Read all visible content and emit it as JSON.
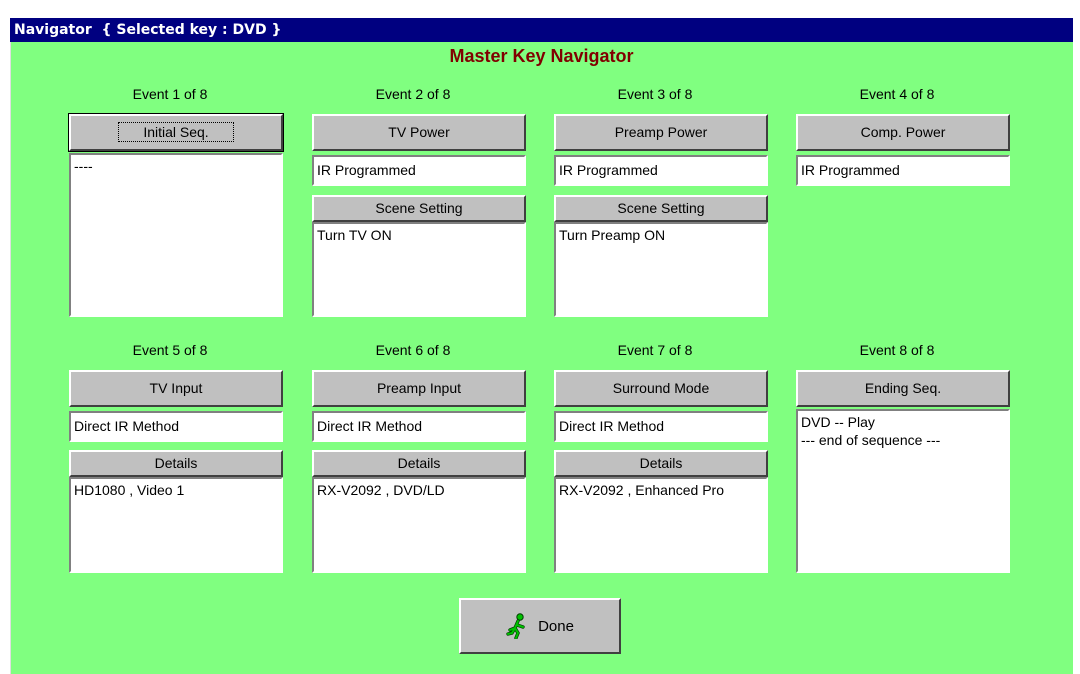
{
  "window": {
    "title": "Navigator  { Selected key : DVD }",
    "heading": "Master Key Navigator"
  },
  "events": [
    {
      "label": "Event 1 of 8",
      "button": "Initial Seq.",
      "text": "----"
    },
    {
      "label": "Event 2 of 8",
      "button": "TV Power",
      "status": "IR Programmed",
      "sub_button": "Scene Setting",
      "sub_text": "Turn TV ON"
    },
    {
      "label": "Event 3 of 8",
      "button": "Preamp Power",
      "status": "IR Programmed",
      "sub_button": "Scene Setting",
      "sub_text": "Turn Preamp ON"
    },
    {
      "label": "Event 4 of 8",
      "button": "Comp. Power",
      "status": "IR Programmed"
    },
    {
      "label": "Event 5 of 8",
      "button": "TV Input",
      "status": "Direct IR Method",
      "sub_button": "Details",
      "sub_text": "HD1080 , Video 1"
    },
    {
      "label": "Event 6 of 8",
      "button": "Preamp Input",
      "status": "Direct IR Method",
      "sub_button": "Details",
      "sub_text": "RX-V2092 , DVD/LD"
    },
    {
      "label": "Event 7 of 8",
      "button": "Surround Mode",
      "status": "Direct IR Method",
      "sub_button": "Details",
      "sub_text": "RX-V2092 , Enhanced Pro"
    },
    {
      "label": "Event 8 of 8",
      "button": "Ending Seq.",
      "text": "DVD -- Play\n--- end of sequence ---"
    }
  ],
  "done_label": "Done",
  "done_icon": "running-man-icon",
  "colors": {
    "background": "#80ff80",
    "title_bar": "#000080",
    "heading": "#800000"
  }
}
